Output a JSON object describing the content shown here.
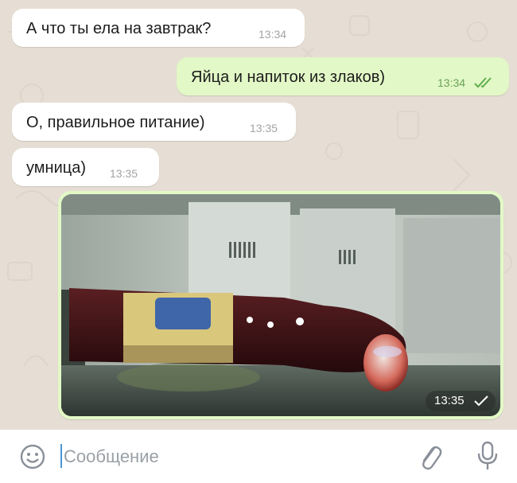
{
  "messages": [
    {
      "direction": "in",
      "text": "А что ты ела на завтрак?",
      "time": "13:34"
    },
    {
      "direction": "out",
      "text": "Яйца и напиток из злаков)",
      "time": "13:34",
      "status": "read"
    },
    {
      "direction": "in",
      "text": "О, правильное питание)",
      "time": "13:35"
    },
    {
      "direction": "in",
      "text": "умница)",
      "time": "13:35"
    }
  ],
  "photo_message": {
    "direction": "out",
    "time": "13:35",
    "status": "sent"
  },
  "composer": {
    "placeholder": "Сообщение"
  },
  "icons": {
    "emoji": "smile-icon",
    "attach": "paperclip-icon",
    "voice": "microphone-icon"
  },
  "colors": {
    "incoming": "#ffffff",
    "outgoing": "#e2f8c6",
    "accent_check": "#5fae4d",
    "background": "#e6ded4"
  }
}
